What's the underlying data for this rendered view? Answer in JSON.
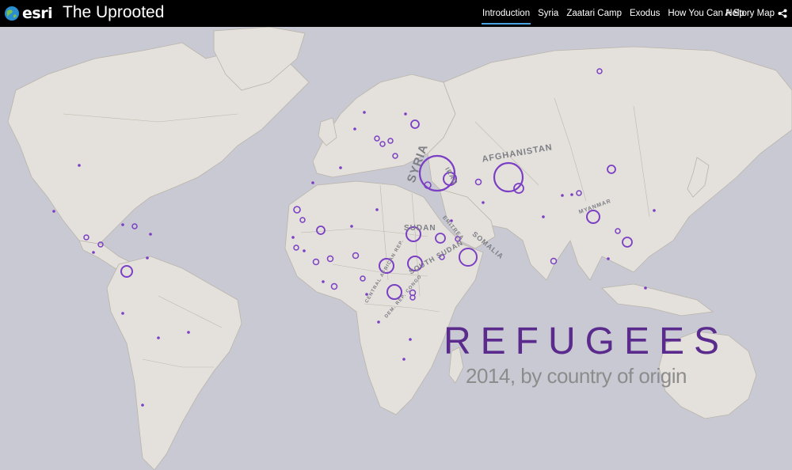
{
  "header": {
    "brand": "esri",
    "title": "The Uprooted",
    "nav": [
      {
        "label": "Introduction",
        "active": true
      },
      {
        "label": "Syria",
        "active": false
      },
      {
        "label": "Zaatari Camp",
        "active": false
      },
      {
        "label": "Exodus",
        "active": false
      },
      {
        "label": "How You Can Help",
        "active": false
      }
    ],
    "story_map_label": "A Story Map",
    "icons": {
      "logo": "globe-icon",
      "share": "share-icon"
    }
  },
  "map": {
    "title": "REFUGEES",
    "subtitle": "2014, by country of origin",
    "colors": {
      "ocean": "#c9c9d3",
      "land": "#e4e1dc",
      "border": "#b9b4aa",
      "symbol": "#7b3fc4",
      "title": "#5a2b8d"
    },
    "country_labels": [
      {
        "text": "SYRIA"
      },
      {
        "text": "IRAQ"
      },
      {
        "text": "AFGHANISTAN"
      },
      {
        "text": "MYANMAR"
      },
      {
        "text": "SUDAN"
      },
      {
        "text": "SOUTH SUDAN"
      },
      {
        "text": "ERITREA"
      },
      {
        "text": "SOMALIA"
      },
      {
        "text": "CENTRAL AFRICAN REP."
      },
      {
        "text": "DEM. REP. CONGO"
      }
    ]
  }
}
